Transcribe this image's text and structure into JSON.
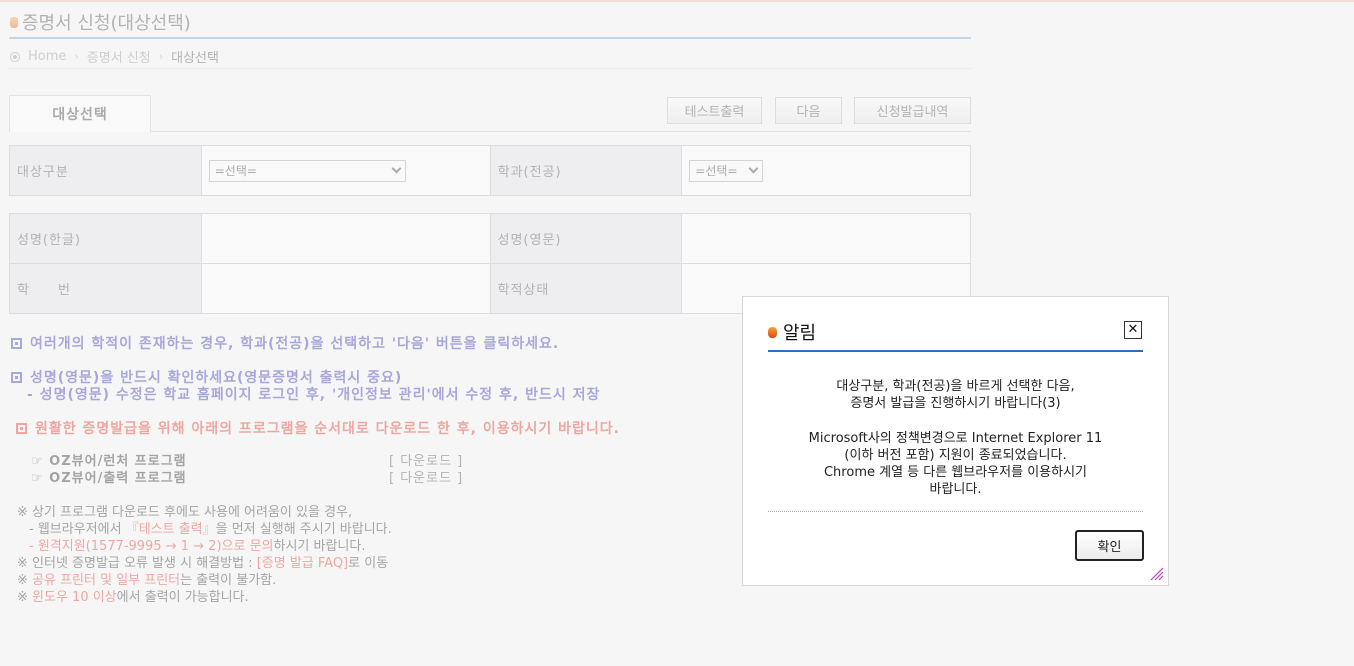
{
  "page": {
    "title": "증명서 신청(대상선택)",
    "breadcrumb": [
      "Home",
      "증명서 신청",
      "대상선택"
    ],
    "tab": "대상선택",
    "buttons": {
      "test_print": "테스트출력",
      "next": "다음",
      "history": "신청발급내역"
    }
  },
  "form": {
    "target_type_label": "대상구분",
    "target_type_value": "=선택=",
    "dept_label": "학과(전공)",
    "dept_value": "=선택=",
    "name_kr_label": "성명(한글)",
    "name_en_label": "성명(영문)",
    "student_no_label": "학　　번",
    "status_label": "학적상태"
  },
  "notices": {
    "n1": "여러개의 학적이 존재하는 경우, 학과(전공)을 선택하고 '다음' 버튼을 클릭하세요.",
    "n2": "성명(영문)을 반드시 확인하세요(영문증명서 출력시 중요)",
    "n2_sub": "- 성명(영문) 수정은 학교 홈페이지 로그인 후, '개인정보 관리'에서 수정 후, 반드시 저장",
    "n3": "원활한 증명발급을 위해 아래의 프로그램을 순서대로 다운로드 한 후, 이용하시기 바랍니다.",
    "programs": [
      {
        "name": "☞ OZ뷰어/런처 프로그램",
        "download": "[ 다운로드 ]"
      },
      {
        "name": "☞ OZ뷰어/출력 프로그램",
        "download": "[ 다운로드 ]"
      }
    ]
  },
  "footer": {
    "f1": "※ 상기 프로그램 다운로드 후에도 사용에 어려움이 있을 경우,",
    "f2_a": "- 웹브라우저에서 ",
    "f2_hl": "『테스트 출력』",
    "f2_b": "을 먼저 실행해 주시기 바랍니다.",
    "f3_hl": "- 원격지원(1577-9995 → 1 → 2)으로 문의",
    "f3_b": "하시기 바랍니다.",
    "f4_a": "※ 인터넷 증명발급 오류 발생 시 해결방법 : ",
    "f4_hl": "[증명 발급 FAQ]",
    "f4_b": "로 이동",
    "f5_a": "※ ",
    "f5_hl": "공유 프린터 및 일부 프린터",
    "f5_b": "는 출력이 불가함.",
    "f6_a": "※ ",
    "f6_hl": "윈도우 10 이상",
    "f6_b": "에서 출력이 가능합니다."
  },
  "modal": {
    "title": "알림",
    "close": "✕",
    "msg1_line1": "대상구분, 학과(전공)을 바르게 선택한 다음,",
    "msg1_line2": "증명서 발급을 진행하시기 바랍니다(3)",
    "msg2_line1": "Microsoft사의 정책변경으로 Internet Explorer 11",
    "msg2_line2": "(이하 버전 포함) 지원이 종료되었습니다.",
    "msg2_line3": "Chrome 계열 등 다른 웹브라우저를 이용하시기",
    "msg2_line4": "바랍니다.",
    "ok": "확인"
  },
  "colors": {
    "accent_blue": "#2a6fc1",
    "notice_blue": "#3b3bb5",
    "notice_red": "#e23b2b"
  }
}
